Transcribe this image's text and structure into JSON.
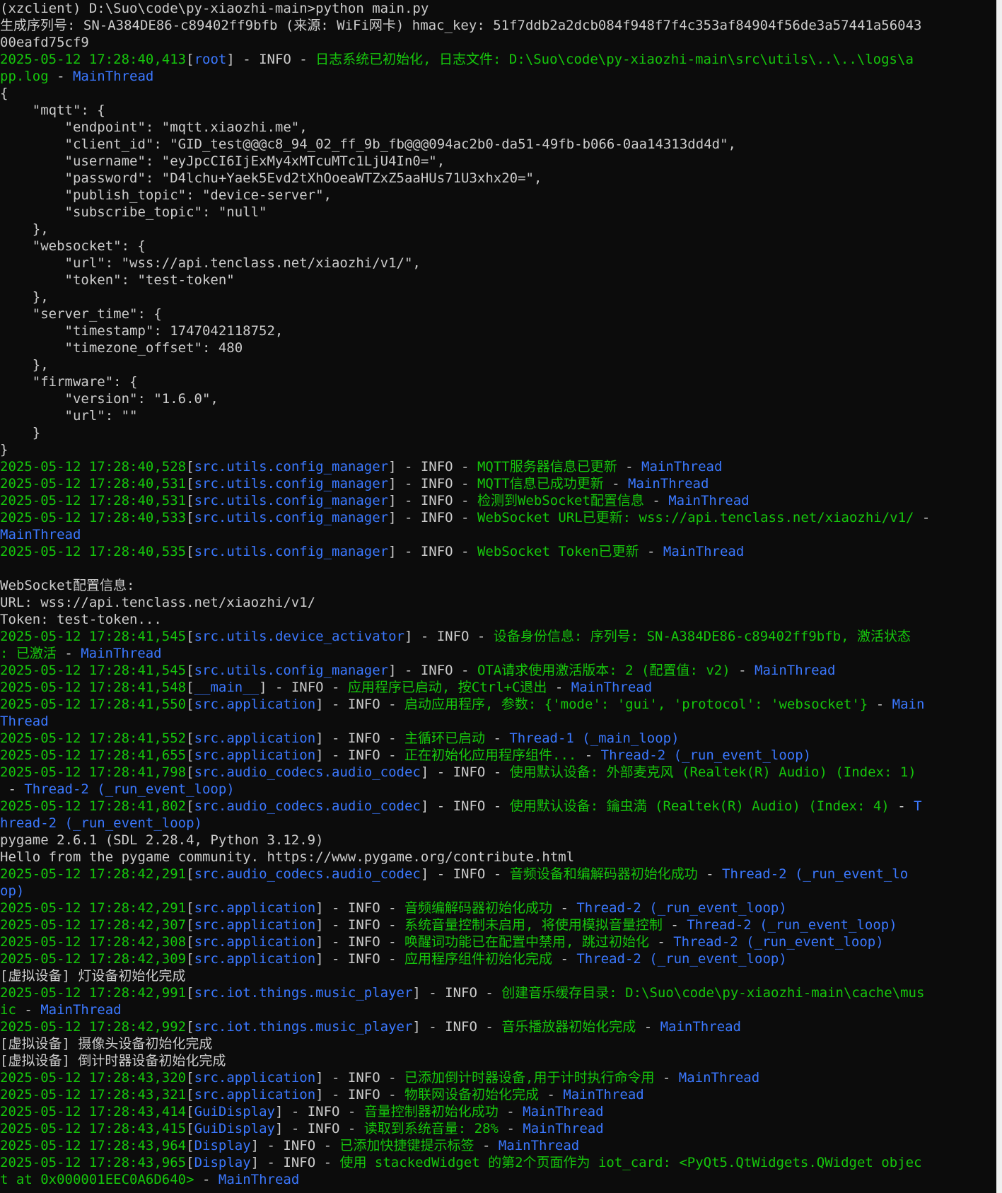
{
  "colors": {
    "background": "#0c0c0c",
    "default_text": "#cccccc",
    "timestamp": "#16c60c",
    "module": "#3b78ff",
    "message": "#16c60c",
    "thread": "#3b78ff"
  },
  "lines": [
    [
      {
        "c": "w",
        "t": "(xzclient) D:\\Suo\\code\\py-xiaozhi-main>python main.py"
      }
    ],
    [
      {
        "c": "w",
        "t": "生成序列号: SN-A384DE86-c89402ff9bfb (来源: WiFi网卡) hmac_key: 51f7ddb2a2dcb084f948f7f4c353af84904f56de3a57441a56043"
      }
    ],
    [
      {
        "c": "w",
        "t": "00eafd75cf9"
      }
    ],
    [
      {
        "c": "t",
        "t": "2025-05-12 17:28:40,413"
      },
      {
        "c": "w",
        "t": "["
      },
      {
        "c": "m",
        "t": "root"
      },
      {
        "c": "w",
        "t": "] - INFO - "
      },
      {
        "c": "g",
        "t": "日志系统已初始化, 日志文件: D:\\Suo\\code\\py-xiaozhi-main\\src\\utils\\..\\..\\logs\\a"
      }
    ],
    [
      {
        "c": "g",
        "t": "pp.log"
      },
      {
        "c": "w",
        "t": " - "
      },
      {
        "c": "m",
        "t": "MainThread"
      }
    ],
    [
      {
        "c": "w",
        "t": "{"
      }
    ],
    [
      {
        "c": "w",
        "t": "    \"mqtt\": {"
      }
    ],
    [
      {
        "c": "w",
        "t": "        \"endpoint\": \"mqtt.xiaozhi.me\","
      }
    ],
    [
      {
        "c": "w",
        "t": "        \"client_id\": \"GID_test@@@c8_94_02_ff_9b_fb@@@094ac2b0-da51-49fb-b066-0aa14313dd4d\","
      }
    ],
    [
      {
        "c": "w",
        "t": "        \"username\": \"eyJpcCI6IjExMy4xMTcuMTc1LjU4In0=\","
      }
    ],
    [
      {
        "c": "w",
        "t": "        \"password\": \"D4lchu+Yaek5Evd2tXhOoeaWTZxZ5aaHUs71U3xhx20=\","
      }
    ],
    [
      {
        "c": "w",
        "t": "        \"publish_topic\": \"device-server\","
      }
    ],
    [
      {
        "c": "w",
        "t": "        \"subscribe_topic\": \"null\""
      }
    ],
    [
      {
        "c": "w",
        "t": "    },"
      }
    ],
    [
      {
        "c": "w",
        "t": "    \"websocket\": {"
      }
    ],
    [
      {
        "c": "w",
        "t": "        \"url\": \"wss://api.tenclass.net/xiaozhi/v1/\","
      }
    ],
    [
      {
        "c": "w",
        "t": "        \"token\": \"test-token\""
      }
    ],
    [
      {
        "c": "w",
        "t": "    },"
      }
    ],
    [
      {
        "c": "w",
        "t": "    \"server_time\": {"
      }
    ],
    [
      {
        "c": "w",
        "t": "        \"timestamp\": 1747042118752,"
      }
    ],
    [
      {
        "c": "w",
        "t": "        \"timezone_offset\": 480"
      }
    ],
    [
      {
        "c": "w",
        "t": "    },"
      }
    ],
    [
      {
        "c": "w",
        "t": "    \"firmware\": {"
      }
    ],
    [
      {
        "c": "w",
        "t": "        \"version\": \"1.6.0\","
      }
    ],
    [
      {
        "c": "w",
        "t": "        \"url\": \"\""
      }
    ],
    [
      {
        "c": "w",
        "t": "    }"
      }
    ],
    [
      {
        "c": "w",
        "t": "}"
      }
    ],
    [
      {
        "c": "t",
        "t": "2025-05-12 17:28:40,528"
      },
      {
        "c": "w",
        "t": "["
      },
      {
        "c": "m",
        "t": "src.utils.config_manager"
      },
      {
        "c": "w",
        "t": "] - INFO - "
      },
      {
        "c": "g",
        "t": "MQTT服务器信息已更新"
      },
      {
        "c": "w",
        "t": " - "
      },
      {
        "c": "m",
        "t": "MainThread"
      }
    ],
    [
      {
        "c": "t",
        "t": "2025-05-12 17:28:40,531"
      },
      {
        "c": "w",
        "t": "["
      },
      {
        "c": "m",
        "t": "src.utils.config_manager"
      },
      {
        "c": "w",
        "t": "] - INFO - "
      },
      {
        "c": "g",
        "t": "MQTT信息已成功更新"
      },
      {
        "c": "w",
        "t": " - "
      },
      {
        "c": "m",
        "t": "MainThread"
      }
    ],
    [
      {
        "c": "t",
        "t": "2025-05-12 17:28:40,531"
      },
      {
        "c": "w",
        "t": "["
      },
      {
        "c": "m",
        "t": "src.utils.config_manager"
      },
      {
        "c": "w",
        "t": "] - INFO - "
      },
      {
        "c": "g",
        "t": "检测到WebSocket配置信息"
      },
      {
        "c": "w",
        "t": " - "
      },
      {
        "c": "m",
        "t": "MainThread"
      }
    ],
    [
      {
        "c": "t",
        "t": "2025-05-12 17:28:40,533"
      },
      {
        "c": "w",
        "t": "["
      },
      {
        "c": "m",
        "t": "src.utils.config_manager"
      },
      {
        "c": "w",
        "t": "] - INFO - "
      },
      {
        "c": "g",
        "t": "WebSocket URL已更新: wss://api.tenclass.net/xiaozhi/v1/"
      },
      {
        "c": "w",
        "t": " -"
      }
    ],
    [
      {
        "c": "m",
        "t": "MainThread"
      }
    ],
    [
      {
        "c": "t",
        "t": "2025-05-12 17:28:40,535"
      },
      {
        "c": "w",
        "t": "["
      },
      {
        "c": "m",
        "t": "src.utils.config_manager"
      },
      {
        "c": "w",
        "t": "] - INFO - "
      },
      {
        "c": "g",
        "t": "WebSocket Token已更新"
      },
      {
        "c": "w",
        "t": " - "
      },
      {
        "c": "m",
        "t": "MainThread"
      }
    ],
    [
      {
        "c": "w",
        "t": ""
      }
    ],
    [
      {
        "c": "w",
        "t": "WebSocket配置信息:"
      }
    ],
    [
      {
        "c": "w",
        "t": "URL: wss://api.tenclass.net/xiaozhi/v1/"
      }
    ],
    [
      {
        "c": "w",
        "t": "Token: test-token..."
      }
    ],
    [
      {
        "c": "t",
        "t": "2025-05-12 17:28:41,545"
      },
      {
        "c": "w",
        "t": "["
      },
      {
        "c": "m",
        "t": "src.utils.device_activator"
      },
      {
        "c": "w",
        "t": "] - INFO - "
      },
      {
        "c": "g",
        "t": "设备身份信息: 序列号: SN-A384DE86-c89402ff9bfb, 激活状态"
      }
    ],
    [
      {
        "c": "g",
        "t": ": 已激活"
      },
      {
        "c": "w",
        "t": " - "
      },
      {
        "c": "m",
        "t": "MainThread"
      }
    ],
    [
      {
        "c": "t",
        "t": "2025-05-12 17:28:41,545"
      },
      {
        "c": "w",
        "t": "["
      },
      {
        "c": "m",
        "t": "src.utils.config_manager"
      },
      {
        "c": "w",
        "t": "] - INFO - "
      },
      {
        "c": "g",
        "t": "OTA请求使用激活版本: 2 (配置值: v2)"
      },
      {
        "c": "w",
        "t": " - "
      },
      {
        "c": "m",
        "t": "MainThread"
      }
    ],
    [
      {
        "c": "t",
        "t": "2025-05-12 17:28:41,548"
      },
      {
        "c": "w",
        "t": "["
      },
      {
        "c": "m",
        "t": "__main__"
      },
      {
        "c": "w",
        "t": "] - INFO - "
      },
      {
        "c": "g",
        "t": "应用程序已启动, 按Ctrl+C退出"
      },
      {
        "c": "w",
        "t": " - "
      },
      {
        "c": "m",
        "t": "MainThread"
      }
    ],
    [
      {
        "c": "t",
        "t": "2025-05-12 17:28:41,550"
      },
      {
        "c": "w",
        "t": "["
      },
      {
        "c": "m",
        "t": "src.application"
      },
      {
        "c": "w",
        "t": "] - INFO - "
      },
      {
        "c": "g",
        "t": "启动应用程序, 参数: {'mode': 'gui', 'protocol': 'websocket'}"
      },
      {
        "c": "w",
        "t": " - "
      },
      {
        "c": "m",
        "t": "Main"
      }
    ],
    [
      {
        "c": "m",
        "t": "Thread"
      }
    ],
    [
      {
        "c": "t",
        "t": "2025-05-12 17:28:41,552"
      },
      {
        "c": "w",
        "t": "["
      },
      {
        "c": "m",
        "t": "src.application"
      },
      {
        "c": "w",
        "t": "] - INFO - "
      },
      {
        "c": "g",
        "t": "主循环已启动"
      },
      {
        "c": "w",
        "t": " - "
      },
      {
        "c": "m",
        "t": "Thread-1 (_main_loop)"
      }
    ],
    [
      {
        "c": "t",
        "t": "2025-05-12 17:28:41,655"
      },
      {
        "c": "w",
        "t": "["
      },
      {
        "c": "m",
        "t": "src.application"
      },
      {
        "c": "w",
        "t": "] - INFO - "
      },
      {
        "c": "g",
        "t": "正在初始化应用程序组件..."
      },
      {
        "c": "w",
        "t": " - "
      },
      {
        "c": "m",
        "t": "Thread-2 (_run_event_loop)"
      }
    ],
    [
      {
        "c": "t",
        "t": "2025-05-12 17:28:41,798"
      },
      {
        "c": "w",
        "t": "["
      },
      {
        "c": "m",
        "t": "src.audio_codecs.audio_codec"
      },
      {
        "c": "w",
        "t": "] - INFO - "
      },
      {
        "c": "g",
        "t": "使用默认设备: 外部麦克风 (Realtek(R) Audio) (Index: 1)"
      }
    ],
    [
      {
        "c": "w",
        "t": " - "
      },
      {
        "c": "m",
        "t": "Thread-2 (_run_event_loop)"
      }
    ],
    [
      {
        "c": "t",
        "t": "2025-05-12 17:28:41,802"
      },
      {
        "c": "w",
        "t": "["
      },
      {
        "c": "m",
        "t": "src.audio_codecs.audio_codec"
      },
      {
        "c": "w",
        "t": "] - INFO - "
      },
      {
        "c": "g",
        "t": "使用默认设备: 鑰虫満 (Realtek(R) Audio) (Index: 4)"
      },
      {
        "c": "w",
        "t": " - "
      },
      {
        "c": "m",
        "t": "T"
      }
    ],
    [
      {
        "c": "m",
        "t": "hread-2 (_run_event_loop)"
      }
    ],
    [
      {
        "c": "w",
        "t": "pygame 2.6.1 (SDL 2.28.4, Python 3.12.9)"
      }
    ],
    [
      {
        "c": "w",
        "t": "Hello from the pygame community. https://www.pygame.org/contribute.html"
      }
    ],
    [
      {
        "c": "t",
        "t": "2025-05-12 17:28:42,291"
      },
      {
        "c": "w",
        "t": "["
      },
      {
        "c": "m",
        "t": "src.audio_codecs.audio_codec"
      },
      {
        "c": "w",
        "t": "] - INFO - "
      },
      {
        "c": "g",
        "t": "音频设备和编解码器初始化成功"
      },
      {
        "c": "w",
        "t": " - "
      },
      {
        "c": "m",
        "t": "Thread-2 (_run_event_lo"
      }
    ],
    [
      {
        "c": "m",
        "t": "op)"
      }
    ],
    [
      {
        "c": "t",
        "t": "2025-05-12 17:28:42,291"
      },
      {
        "c": "w",
        "t": "["
      },
      {
        "c": "m",
        "t": "src.application"
      },
      {
        "c": "w",
        "t": "] - INFO - "
      },
      {
        "c": "g",
        "t": "音频编解码器初始化成功"
      },
      {
        "c": "w",
        "t": " - "
      },
      {
        "c": "m",
        "t": "Thread-2 (_run_event_loop)"
      }
    ],
    [
      {
        "c": "t",
        "t": "2025-05-12 17:28:42,307"
      },
      {
        "c": "w",
        "t": "["
      },
      {
        "c": "m",
        "t": "src.application"
      },
      {
        "c": "w",
        "t": "] - INFO - "
      },
      {
        "c": "g",
        "t": "系统音量控制未启用, 将使用模拟音量控制"
      },
      {
        "c": "w",
        "t": " - "
      },
      {
        "c": "m",
        "t": "Thread-2 (_run_event_loop)"
      }
    ],
    [
      {
        "c": "t",
        "t": "2025-05-12 17:28:42,308"
      },
      {
        "c": "w",
        "t": "["
      },
      {
        "c": "m",
        "t": "src.application"
      },
      {
        "c": "w",
        "t": "] - INFO - "
      },
      {
        "c": "g",
        "t": "唤醒词功能已在配置中禁用, 跳过初始化"
      },
      {
        "c": "w",
        "t": " - "
      },
      {
        "c": "m",
        "t": "Thread-2 (_run_event_loop)"
      }
    ],
    [
      {
        "c": "t",
        "t": "2025-05-12 17:28:42,309"
      },
      {
        "c": "w",
        "t": "["
      },
      {
        "c": "m",
        "t": "src.application"
      },
      {
        "c": "w",
        "t": "] - INFO - "
      },
      {
        "c": "g",
        "t": "应用程序组件初始化完成"
      },
      {
        "c": "w",
        "t": " - "
      },
      {
        "c": "m",
        "t": "Thread-2 (_run_event_loop)"
      }
    ],
    [
      {
        "c": "w",
        "t": "[虚拟设备] 灯设备初始化完成"
      }
    ],
    [
      {
        "c": "t",
        "t": "2025-05-12 17:28:42,991"
      },
      {
        "c": "w",
        "t": "["
      },
      {
        "c": "m",
        "t": "src.iot.things.music_player"
      },
      {
        "c": "w",
        "t": "] - INFO - "
      },
      {
        "c": "g",
        "t": "创建音乐缓存目录: D:\\Suo\\code\\py-xiaozhi-main\\cache\\mus"
      }
    ],
    [
      {
        "c": "g",
        "t": "ic"
      },
      {
        "c": "w",
        "t": " - "
      },
      {
        "c": "m",
        "t": "MainThread"
      }
    ],
    [
      {
        "c": "t",
        "t": "2025-05-12 17:28:42,992"
      },
      {
        "c": "w",
        "t": "["
      },
      {
        "c": "m",
        "t": "src.iot.things.music_player"
      },
      {
        "c": "w",
        "t": "] - INFO - "
      },
      {
        "c": "g",
        "t": "音乐播放器初始化完成"
      },
      {
        "c": "w",
        "t": " - "
      },
      {
        "c": "m",
        "t": "MainThread"
      }
    ],
    [
      {
        "c": "w",
        "t": "[虚拟设备] 摄像头设备初始化完成"
      }
    ],
    [
      {
        "c": "w",
        "t": "[虚拟设备] 倒计时器设备初始化完成"
      }
    ],
    [
      {
        "c": "t",
        "t": "2025-05-12 17:28:43,320"
      },
      {
        "c": "w",
        "t": "["
      },
      {
        "c": "m",
        "t": "src.application"
      },
      {
        "c": "w",
        "t": "] - INFO - "
      },
      {
        "c": "g",
        "t": "已添加倒计时器设备,用于计时执行命令用"
      },
      {
        "c": "w",
        "t": " - "
      },
      {
        "c": "m",
        "t": "MainThread"
      }
    ],
    [
      {
        "c": "t",
        "t": "2025-05-12 17:28:43,321"
      },
      {
        "c": "w",
        "t": "["
      },
      {
        "c": "m",
        "t": "src.application"
      },
      {
        "c": "w",
        "t": "] - INFO - "
      },
      {
        "c": "g",
        "t": "物联网设备初始化完成"
      },
      {
        "c": "w",
        "t": " - "
      },
      {
        "c": "m",
        "t": "MainThread"
      }
    ],
    [
      {
        "c": "t",
        "t": "2025-05-12 17:28:43,414"
      },
      {
        "c": "w",
        "t": "["
      },
      {
        "c": "m",
        "t": "GuiDisplay"
      },
      {
        "c": "w",
        "t": "] - INFO - "
      },
      {
        "c": "g",
        "t": "音量控制器初始化成功"
      },
      {
        "c": "w",
        "t": " - "
      },
      {
        "c": "m",
        "t": "MainThread"
      }
    ],
    [
      {
        "c": "t",
        "t": "2025-05-12 17:28:43,415"
      },
      {
        "c": "w",
        "t": "["
      },
      {
        "c": "m",
        "t": "GuiDisplay"
      },
      {
        "c": "w",
        "t": "] - INFO - "
      },
      {
        "c": "g",
        "t": "读取到系统音量: 28%"
      },
      {
        "c": "w",
        "t": " - "
      },
      {
        "c": "m",
        "t": "MainThread"
      }
    ],
    [
      {
        "c": "t",
        "t": "2025-05-12 17:28:43,964"
      },
      {
        "c": "w",
        "t": "["
      },
      {
        "c": "m",
        "t": "Display"
      },
      {
        "c": "w",
        "t": "] - INFO - "
      },
      {
        "c": "g",
        "t": "已添加快捷键提示标签"
      },
      {
        "c": "w",
        "t": " - "
      },
      {
        "c": "m",
        "t": "MainThread"
      }
    ],
    [
      {
        "c": "t",
        "t": "2025-05-12 17:28:43,965"
      },
      {
        "c": "w",
        "t": "["
      },
      {
        "c": "m",
        "t": "Display"
      },
      {
        "c": "w",
        "t": "] - INFO - "
      },
      {
        "c": "g",
        "t": "使用 stackedWidget 的第2个页面作为 iot_card: <PyQt5.QtWidgets.QWidget objec"
      }
    ],
    [
      {
        "c": "g",
        "t": "t at 0x000001EEC0A6D640>"
      },
      {
        "c": "w",
        "t": " - "
      },
      {
        "c": "m",
        "t": "MainThread"
      }
    ]
  ]
}
